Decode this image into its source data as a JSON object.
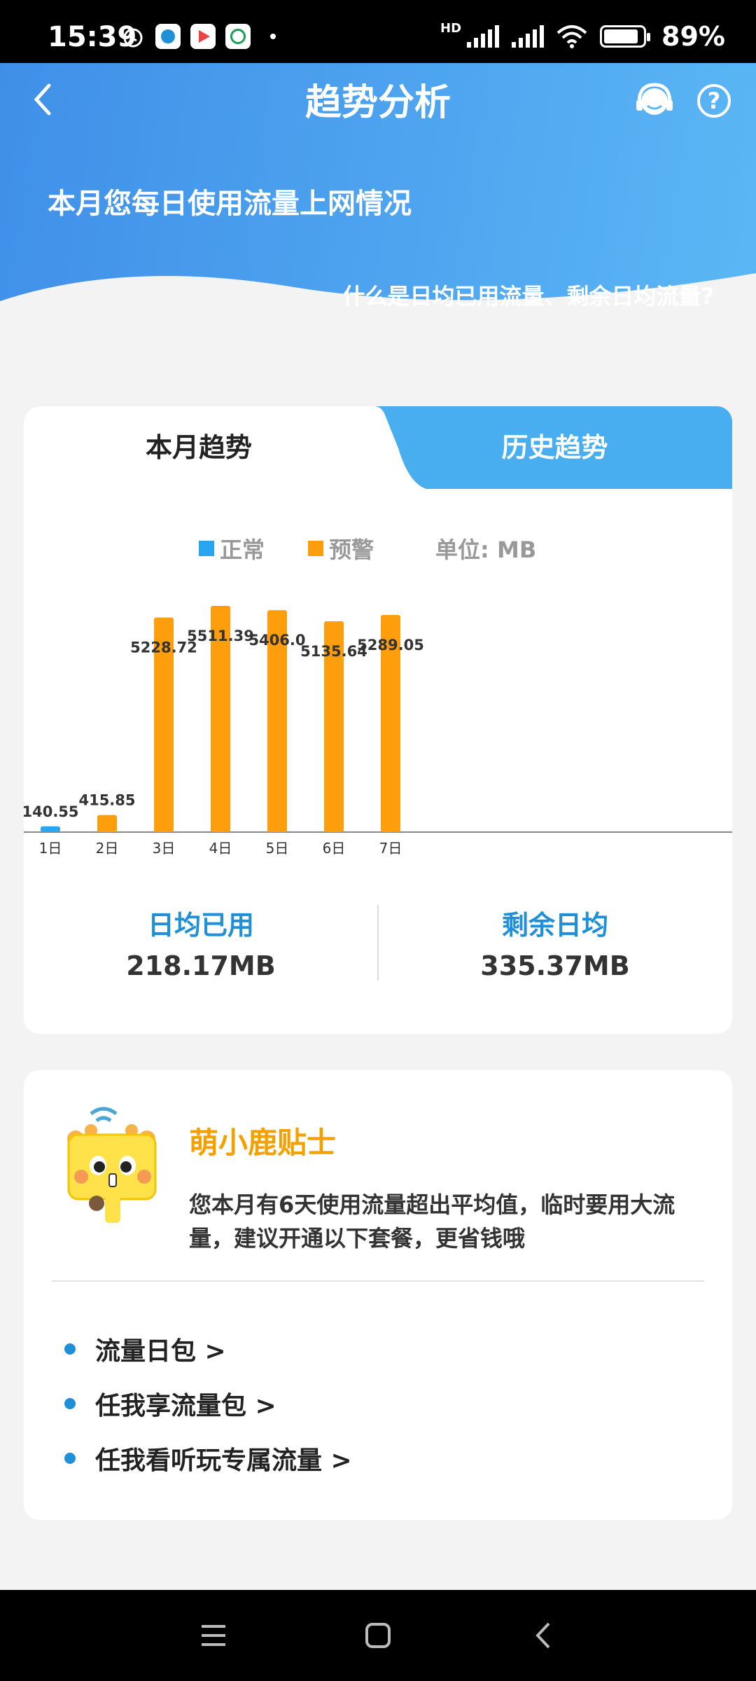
{
  "status_bar": {
    "time": "15:39",
    "signal_label": "HD",
    "battery": "89%"
  },
  "header": {
    "title": "趋势分析",
    "subtitle": "本月您每日使用流量上网情况",
    "info_link": "什么是日均已用流量、剩余日均流量?"
  },
  "tabs": {
    "current": "本月趋势",
    "history": "历史趋势"
  },
  "legend": {
    "normal": "正常",
    "warning": "预警",
    "unit": "单位: MB"
  },
  "colors": {
    "normal": "#2aa6f0",
    "warning": "#ff9e0d",
    "header_start": "#3f8fe8",
    "header_end": "#5bb7f5",
    "accent_blue": "#1f8fd8",
    "tips_orange": "#f4a100"
  },
  "chart_data": {
    "type": "bar",
    "categories": [
      "1日",
      "2日",
      "3日",
      "4日",
      "5日",
      "6日",
      "7日"
    ],
    "values": [
      140.55,
      415.85,
      5228.72,
      5511.39,
      5406.0,
      5135.64,
      5289.05
    ],
    "value_labels": [
      "140.55",
      "415.85",
      "5228.72",
      "5511.39",
      "5406.0",
      "5135.64",
      "5289.05"
    ],
    "status": [
      "normal",
      "warning",
      "warning",
      "warning",
      "warning",
      "warning",
      "warning"
    ],
    "ylabel": "",
    "legend_position": "top-center"
  },
  "stats": {
    "avg_used_label": "日均已用",
    "avg_used_value": "218.17MB",
    "remaining_label": "剩余日均",
    "remaining_value": "335.37MB"
  },
  "tips": {
    "title": "萌小鹿贴士",
    "text": "您本月有6天使用流量超出平均值，临时要用大流量，建议开通以下套餐，更省钱哦",
    "packages": [
      "流量日包 >",
      "任我享流量包 >",
      "任我看听玩专属流量 >"
    ]
  },
  "icons": {
    "back": "back-arrow-icon",
    "service": "customer-service-icon",
    "help": "help-icon"
  }
}
